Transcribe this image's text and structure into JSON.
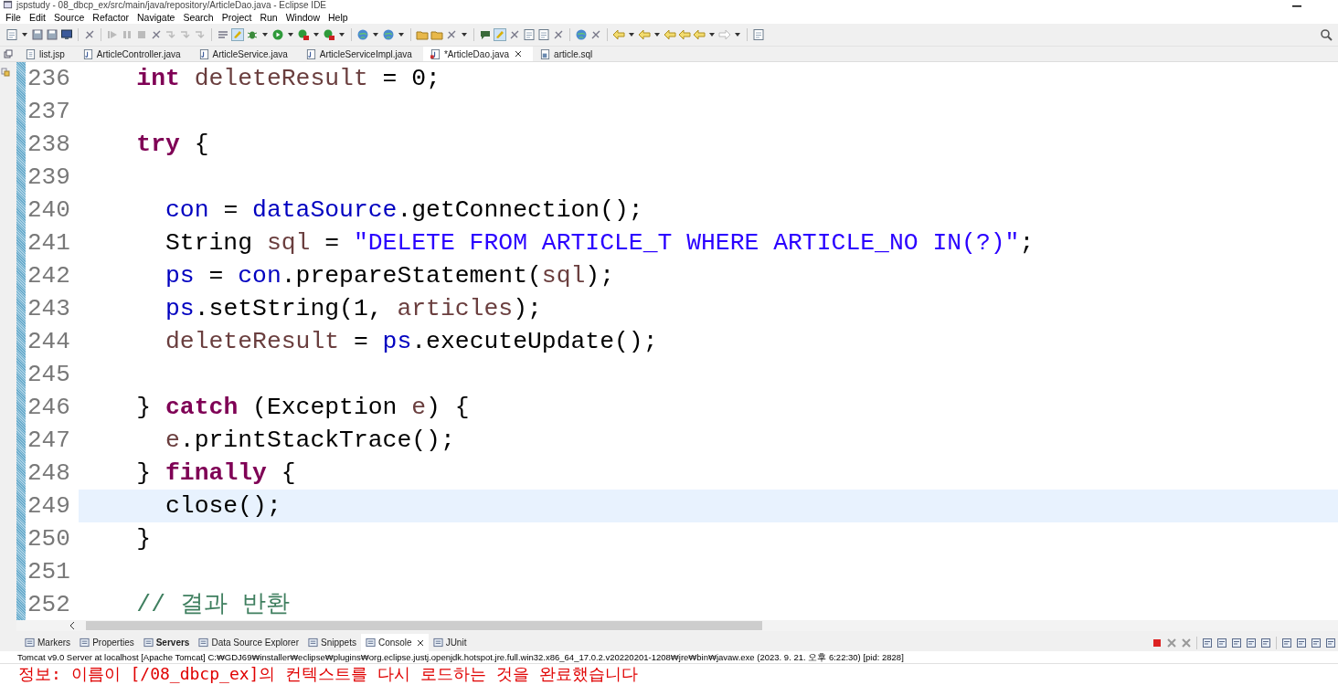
{
  "window": {
    "title": "jspstudy - 08_dbcp_ex/src/main/java/repository/ArticleDao.java - Eclipse IDE"
  },
  "menu": [
    "File",
    "Edit",
    "Source",
    "Refactor",
    "Navigate",
    "Search",
    "Project",
    "Run",
    "Window",
    "Help"
  ],
  "editor_tabs": [
    {
      "label": "list.jsp",
      "kind": "jsp",
      "selected": false
    },
    {
      "label": "ArticleController.java",
      "kind": "java",
      "selected": false
    },
    {
      "label": "ArticleService.java",
      "kind": "java",
      "selected": false
    },
    {
      "label": "ArticleServiceImpl.java",
      "kind": "java",
      "selected": false
    },
    {
      "label": "*ArticleDao.java",
      "kind": "java",
      "selected": true
    },
    {
      "label": "article.sql",
      "kind": "sql",
      "selected": false
    }
  ],
  "code_lines": [
    {
      "number": "236",
      "current": false,
      "tokens": [
        {
          "kind": "keyword",
          "text": "    int"
        },
        {
          "kind": "local",
          "text": " deleteResult"
        },
        {
          "kind": "plain",
          "text": " = 0;"
        }
      ]
    },
    {
      "number": "237",
      "current": false
    },
    {
      "number": "238",
      "current": false,
      "tokens": [
        {
          "kind": "keyword",
          "text": "    try"
        },
        {
          "kind": "plain",
          "text": " {"
        }
      ]
    },
    {
      "number": "239",
      "current": false
    },
    {
      "number": "240",
      "current": false,
      "tokens": [
        {
          "kind": "field",
          "text": "      con"
        },
        {
          "kind": "plain",
          "text": " = "
        },
        {
          "kind": "field",
          "text": "dataSource"
        },
        {
          "kind": "plain",
          "text": ".getConnection();"
        }
      ]
    },
    {
      "number": "241",
      "current": false,
      "tokens": [
        {
          "kind": "plain",
          "text": "      String "
        },
        {
          "kind": "local",
          "text": "sql"
        },
        {
          "kind": "plain",
          "text": " = "
        },
        {
          "kind": "string",
          "text": "\"DELETE FROM ARTICLE_T WHERE ARTICLE_NO IN(?)\""
        },
        {
          "kind": "plain",
          "text": ";"
        }
      ]
    },
    {
      "number": "242",
      "current": false,
      "tokens": [
        {
          "kind": "field",
          "text": "      ps"
        },
        {
          "kind": "plain",
          "text": " = "
        },
        {
          "kind": "field",
          "text": "con"
        },
        {
          "kind": "plain",
          "text": ".prepareStatement("
        },
        {
          "kind": "local",
          "text": "sql"
        },
        {
          "kind": "plain",
          "text": ");"
        }
      ]
    },
    {
      "number": "243",
      "current": false,
      "tokens": [
        {
          "kind": "field",
          "text": "      ps"
        },
        {
          "kind": "plain",
          "text": ".setString(1, "
        },
        {
          "kind": "local",
          "text": "articles"
        },
        {
          "kind": "plain",
          "text": ");"
        }
      ]
    },
    {
      "number": "244",
      "current": false,
      "tokens": [
        {
          "kind": "local",
          "text": "      deleteResult"
        },
        {
          "kind": "plain",
          "text": " = "
        },
        {
          "kind": "field",
          "text": "ps"
        },
        {
          "kind": "plain",
          "text": ".executeUpdate();"
        }
      ]
    },
    {
      "number": "245",
      "current": false
    },
    {
      "number": "246",
      "current": false,
      "tokens": [
        {
          "kind": "plain",
          "text": "    } "
        },
        {
          "kind": "keyword",
          "text": "catch"
        },
        {
          "kind": "plain",
          "text": " (Exception "
        },
        {
          "kind": "local",
          "text": "e"
        },
        {
          "kind": "plain",
          "text": ") {"
        }
      ]
    },
    {
      "number": "247",
      "current": false,
      "tokens": [
        {
          "kind": "local",
          "text": "      e"
        },
        {
          "kind": "plain",
          "text": ".printStackTrace();"
        }
      ]
    },
    {
      "number": "248",
      "current": false,
      "tokens": [
        {
          "kind": "plain",
          "text": "    } "
        },
        {
          "kind": "keyword",
          "text": "finally"
        },
        {
          "kind": "plain",
          "text": " {"
        }
      ]
    },
    {
      "number": "249",
      "current": true,
      "tokens": [
        {
          "kind": "plain",
          "text": "      close();"
        }
      ]
    },
    {
      "number": "250",
      "current": false,
      "tokens": [
        {
          "kind": "plain",
          "text": "    }"
        }
      ]
    },
    {
      "number": "251",
      "current": false
    },
    {
      "number": "252",
      "current": false,
      "tokens": [
        {
          "kind": "comment",
          "text": "    // 결과 반환"
        }
      ]
    }
  ],
  "bottom_tabs": [
    {
      "label": "Markers",
      "bold": false,
      "selected": false
    },
    {
      "label": "Properties",
      "bold": false,
      "selected": false
    },
    {
      "label": "Servers",
      "bold": true,
      "selected": false
    },
    {
      "label": "Data Source Explorer",
      "bold": false,
      "selected": false
    },
    {
      "label": "Snippets",
      "bold": false,
      "selected": false
    },
    {
      "label": "Console",
      "bold": false,
      "selected": true
    },
    {
      "label": "JUnit",
      "bold": false,
      "selected": false
    }
  ],
  "console": {
    "header": "Tomcat v9.0 Server at localhost [Apache Tomcat] C:₩GDJ69₩installer₩eclipse₩plugins₩org.eclipse.justj.openjdk.hotspot.jre.full.win32.x86_64_17.0.2.v20220201-1208₩jre₩bin₩javaw.exe  (2023. 9. 21. 오후 6:22:30) [pid: 2828]",
    "lines": [
      {
        "text": "정보: 이름이 [/08_dbcp_ex]의 컨텍스트를 다시 로드하는 것을 완료했습니다",
        "kind": "error"
      }
    ]
  }
}
